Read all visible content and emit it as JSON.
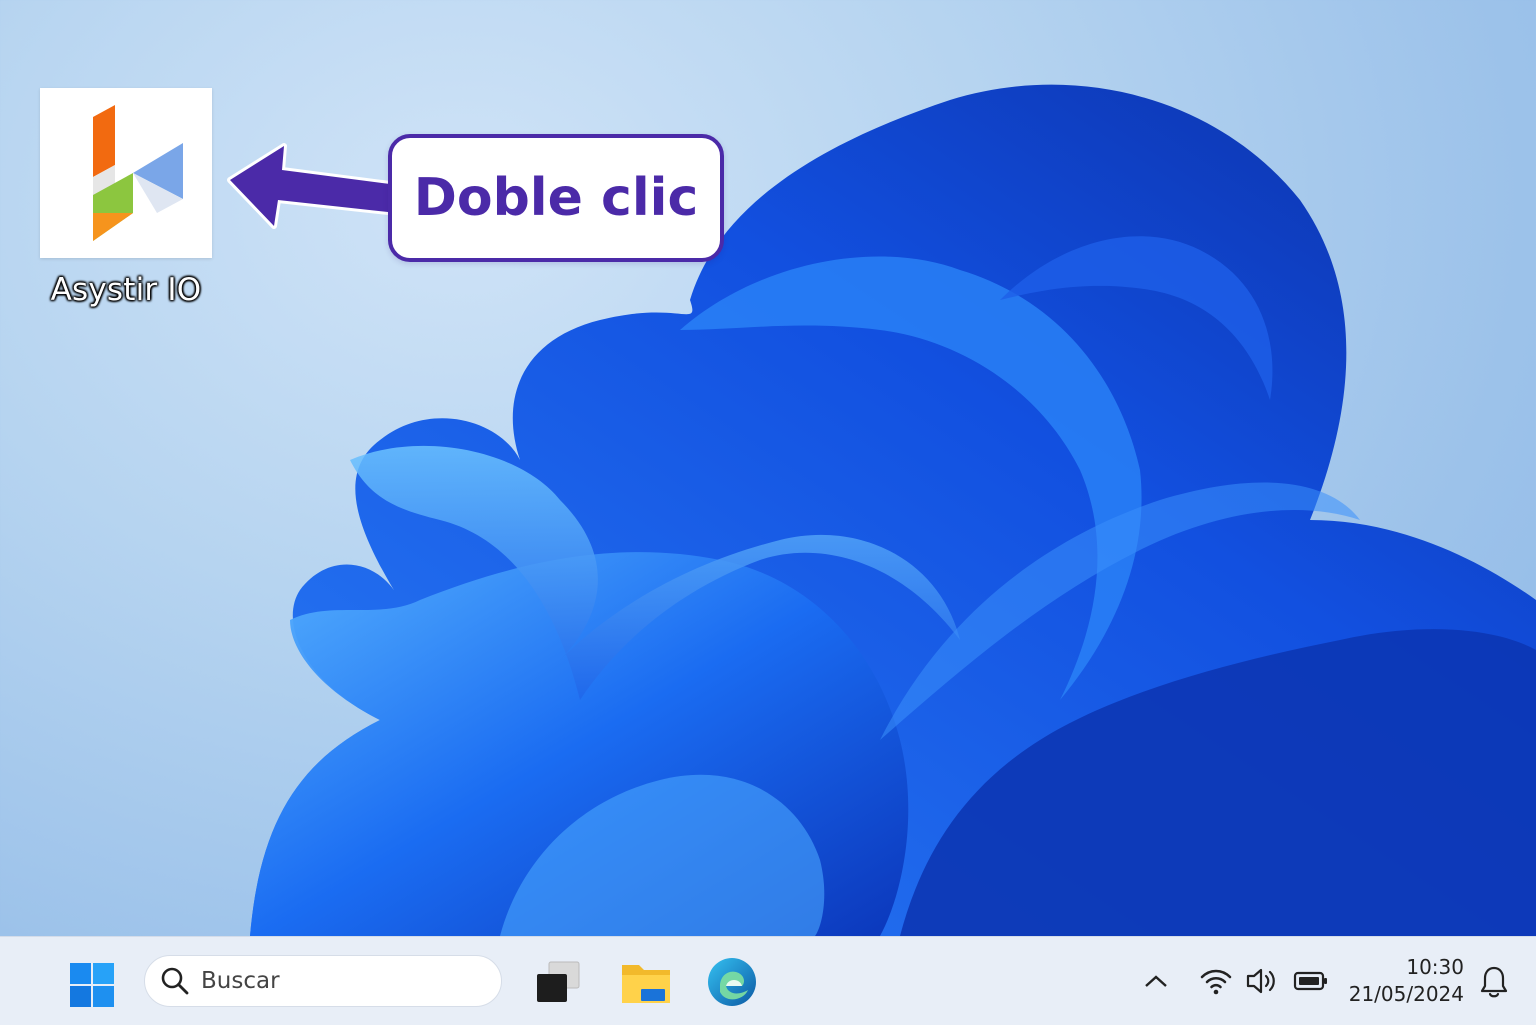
{
  "desktop": {
    "icon_label": "Asystir IO",
    "callout_text": "Doble clic",
    "callout_color": "#4b2aa8"
  },
  "taskbar": {
    "search_placeholder": "Buscar",
    "time": "10:30",
    "date": "21/05/2024",
    "icons": [
      "windows-start-icon",
      "search-icon",
      "task-view-icon",
      "file-explorer-icon",
      "edge-browser-icon",
      "chevron-up-icon",
      "wifi-icon",
      "volume-icon",
      "battery-icon",
      "notification-bell-icon"
    ],
    "accent": "#0078d4"
  }
}
